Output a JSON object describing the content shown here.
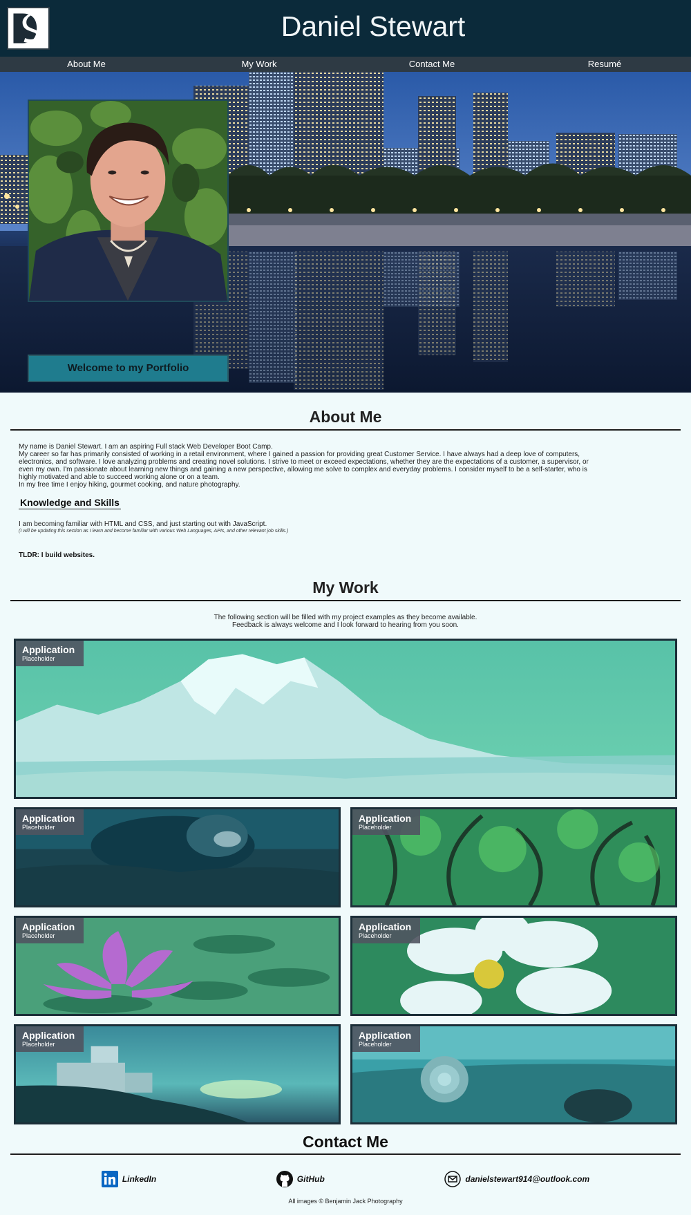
{
  "header": {
    "title": "Daniel Stewart",
    "logo_icon": "ds-logo"
  },
  "nav": {
    "items": [
      "About Me",
      "My Work",
      "Contact Me",
      "Resumé"
    ]
  },
  "hero": {
    "welcome": "Welcome to my Portfolio"
  },
  "about": {
    "title": "About Me",
    "lines": [
      "My name is Daniel Stewart. I am an aspiring Full stack Web Developer Boot Camp.",
      "My career so far has primarily consisted of working in a retail environment, where I gained a passion for providing great Customer Service. I have always had a deep love of computers, electronics, and software. I love analyzing problems and creating novel solutions. I strive to meet or exceed expectations, whether they are the expectations of a customer, a supervisor, or even my own. I'm passionate about learning new things and gaining a new perspective, allowing me solve to complex and everyday problems. I consider myself to be a self-starter, who is highly motivated and able to succeed working alone or on a team.",
      "In my free time I enjoy hiking, gourmet cooking, and nature photography."
    ],
    "skills_title": "Knowledge and Skills",
    "skills_text": "I am becoming familiar with HTML and CSS, and just starting out with JavaScript.",
    "skills_note": "(I will be updating this section as I learn and become familiar with various Web Languages, APIs, and other relevant job skills.)",
    "tldr": "TLDR: I build websites."
  },
  "work": {
    "title": "My Work",
    "intro_1": "The following section will be filled with my project examples as they become available.",
    "intro_2": "Feedback is always welcome and I look forward to hearing from you soon.",
    "card_title": "Application",
    "card_sub": "Placeholder"
  },
  "contact": {
    "title": "Contact Me",
    "linkedin": "LinkedIn",
    "github": "GitHub",
    "email": "danielstewart914@outlook.com"
  },
  "footer": {
    "text": "All images © Benjamin Jack Photography"
  },
  "colors": {
    "header_bg": "#0b2a3a",
    "nav_bg": "#2e3a44",
    "page_bg": "#f0fafb",
    "accent": "#1f7c8e"
  }
}
